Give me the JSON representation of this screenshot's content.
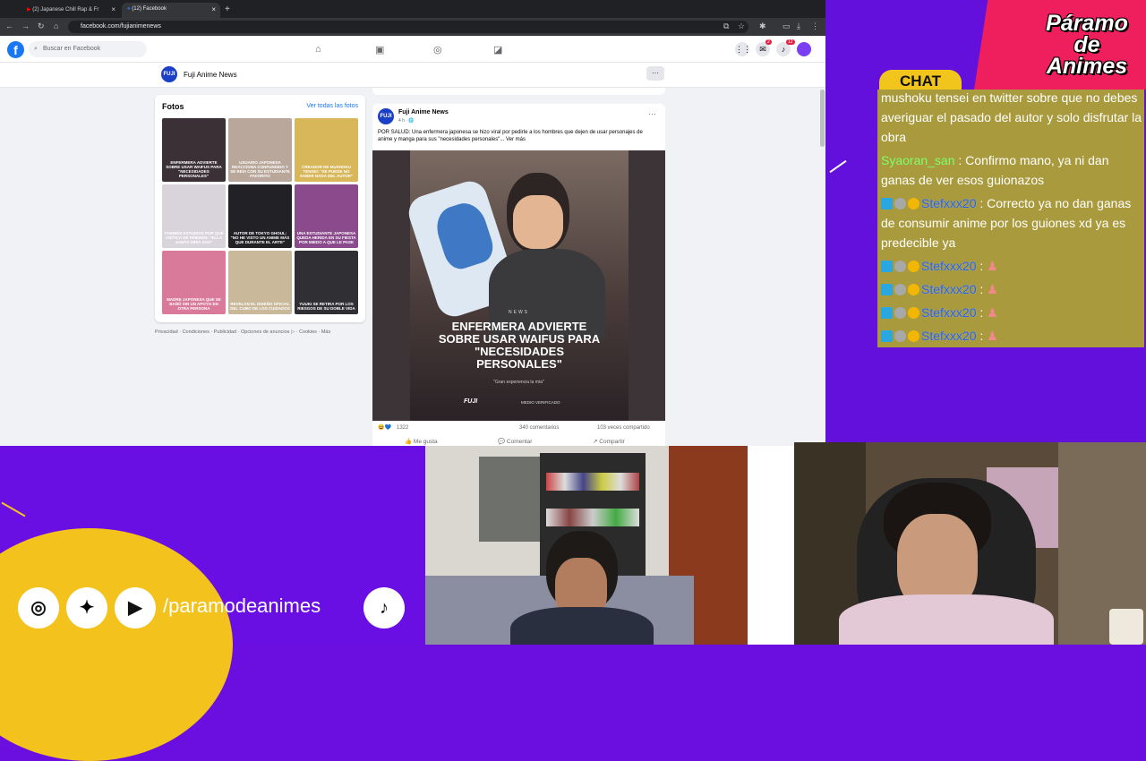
{
  "browser": {
    "tabs": [
      {
        "label": "(2) Japanese Chill Rap & Fr",
        "active": false
      },
      {
        "label": "(12) Facebook",
        "active": true
      }
    ],
    "url": "facebook.com/fujianimenews"
  },
  "facebook": {
    "search_placeholder": "Buscar en Facebook",
    "badges": {
      "messenger": "2",
      "notifications": "12"
    },
    "page_name": "Fuji Anime News",
    "more_btn": "···",
    "photos": {
      "title": "Fotos",
      "see_all": "Ver todas las fotos",
      "items": [
        {
          "caption": "ENFERMERA ADVIERTE SOBRE USAR WAIFUS PARA \"NECESIDADES PERSONALES\"",
          "color": "#3a3035"
        },
        {
          "caption": "USUARIO JAPONESA REACCIONA CONFUNDIDO Y SE REÍA CON SU ESTUDIANTE FAVORITO",
          "color": "#b8a79a"
        },
        {
          "caption": "CREADOR DE MUSHOKU TENSEI: \"SE PUEDE NO SABER NADA DEL AUTOR\"",
          "color": "#d8b65a"
        },
        {
          "caption": "TAMBIÉN ESTUDIOS POR QUÉ CRÍTICA DE FRIEREN: \"ELLA JAMÁS DIRÍA ESO\"",
          "color": "#d9d4dc"
        },
        {
          "caption": "AUTOR DE TOKYO GHOUL: \"NO HE VISTO UN ANIME MÁS QUE DURANTE EL ARTE\"",
          "color": "#222226"
        },
        {
          "caption": "UNA ESTUDIANTE JAPONESA QUEDA HERIDA EN SU FIESTA POR MIEDO A QUE LE PASE",
          "color": "#8a4a8c"
        },
        {
          "caption": "MADRE JAPONESA QUE SE BAÑÓ SIN UN APOYO EN OTRA PERSONA",
          "color": "#d97a9a"
        },
        {
          "caption": "REVELAN EL DISEÑO OFICIAL DEL CUBO DE LOS CUIDADOS",
          "color": "#c9b89a"
        },
        {
          "caption": "YUUKI SE RETIRA POR LOS RIESGOS DE SU DOBLE VIDA",
          "color": "#303034"
        }
      ]
    },
    "footer": "Privacidad · Condiciones · Publicidad · Opciones de anuncios ▷ · Cookies · Más",
    "post": {
      "author": "Fuji Anime News",
      "time": "4 h · 🌐",
      "text": "POR SALUD: Una enfermera japonesa se hizo viral por pedirle a los hombres que dejen de usar personajes de anime y manga para sus \"necesidades personales\"... Ver más",
      "image_tag": "NEWS",
      "image_headline": "ENFERMERA ADVIERTE SOBRE USAR WAIFUS PARA \"NECESIDADES PERSONALES\"",
      "image_sub": "\"Gran experiencia la mía\"",
      "image_brand": "FUJI",
      "image_verified": "MEDIO VERIFICADO",
      "reactions": "1322",
      "comments": "340 comentarios",
      "shares": "103 veces compartido",
      "like": "Me gusta",
      "comment": "Comentar",
      "share": "Compartir"
    }
  },
  "stream": {
    "brand": "Páramo de Animes",
    "brand_lines": [
      "Páramo",
      "de",
      "Animes"
    ],
    "chat_label": "CHAT",
    "messages": [
      {
        "user": "",
        "text": "mushoku tensei en twitter sobre que no debes averiguar el pasado del autor y solo disfrutar la obra"
      },
      {
        "user": "Syaoran_san",
        "text": " : Confirmo mano, ya ni dan ganas de ver esos guionazos"
      },
      {
        "user": "Stefxxx20",
        "text": " : Correcto ya no dan ganas de consumir anime por los guiones xd ya es predecible ya"
      },
      {
        "user": "Stefxxx20",
        "text": " :"
      },
      {
        "user": "Stefxxx20",
        "text": " :"
      },
      {
        "user": "Stefxxx20",
        "text": " :"
      },
      {
        "user": "Stefxxx20",
        "text": " :"
      }
    ],
    "handle": "/paramodeanimes",
    "social_icons": [
      "instagram-icon",
      "twitter-icon",
      "youtube-icon",
      "tiktok-icon"
    ]
  }
}
